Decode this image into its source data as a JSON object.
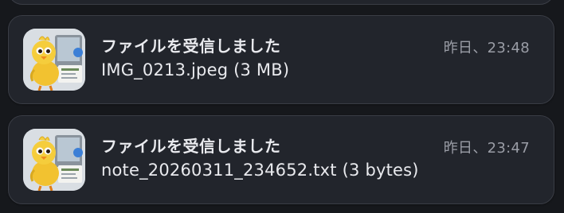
{
  "notifications": [
    {
      "app_icon": "file-transfer-chick-icon",
      "title": "ファイルを受信しました",
      "time": "昨日、23:48",
      "body": "IMG_0213.jpeg (3 MB)"
    },
    {
      "app_icon": "file-transfer-chick-icon",
      "title": "ファイルを受信しました",
      "time": "昨日、23:47",
      "body": "note_20260311_234652.txt (3 bytes)"
    }
  ],
  "colors": {
    "background": "#16181c",
    "card": "#22252c",
    "card_border": "#3a3d45",
    "title_text": "#e9eaee",
    "time_text": "#9a9da6",
    "chick_yellow": "#f2c230"
  }
}
